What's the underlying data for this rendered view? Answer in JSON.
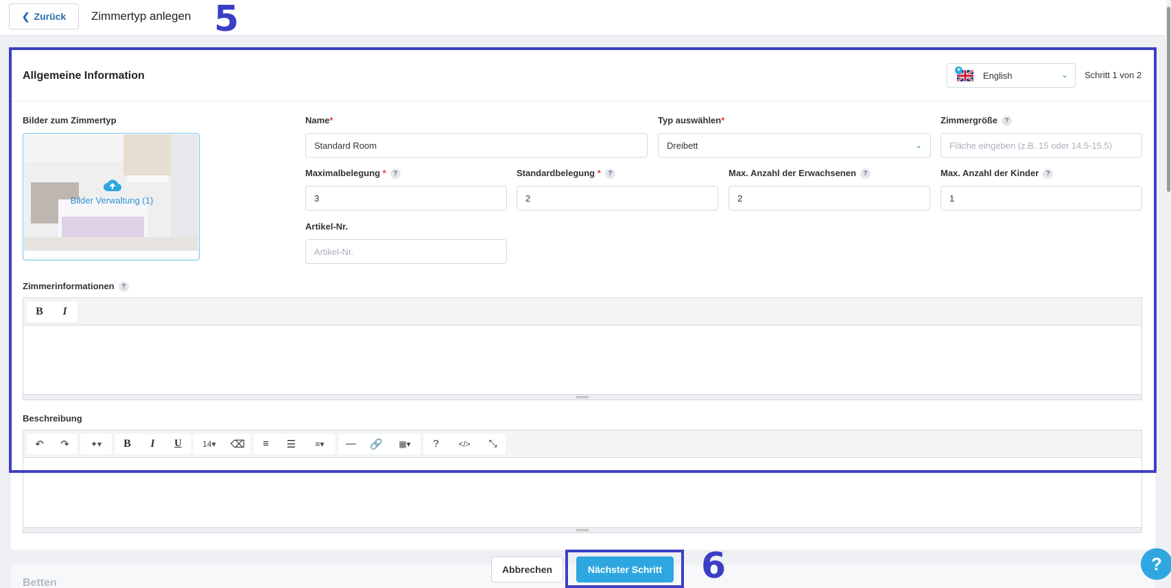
{
  "header": {
    "back_label": "Zurück",
    "title": "Zimmertyp anlegen",
    "annotation_step": "5"
  },
  "card": {
    "title": "Allgemeine Information",
    "language": "English",
    "step_text": "Schritt 1 von 2"
  },
  "images": {
    "label": "Bilder zum Zimmertyp",
    "manage_label": "Bilder Verwaltung (1)"
  },
  "fields": {
    "name": {
      "label": "Name",
      "value": "Standard Room"
    },
    "type": {
      "label": "Typ auswählen",
      "value": "Dreibett"
    },
    "size": {
      "label": "Zimmergröße",
      "placeholder": "Fläche eingeben (z.B. 15 oder 14.5-15.5)"
    },
    "max_occupancy": {
      "label": "Maximalbelegung",
      "value": "3"
    },
    "std_occupancy": {
      "label": "Standardbelegung",
      "value": "2"
    },
    "max_adults": {
      "label": "Max. Anzahl der Erwachsenen",
      "value": "2"
    },
    "max_children": {
      "label": "Max. Anzahl der Kinder",
      "value": "1"
    },
    "article_no": {
      "label": "Artikel-Nr.",
      "placeholder": "Artikel-Nr."
    }
  },
  "room_info": {
    "label": "Zimmerinformationen",
    "toolbar": {
      "bold": "B",
      "italic": "I"
    }
  },
  "description": {
    "label": "Beschreibung",
    "toolbar": {
      "bold": "B",
      "italic": "I",
      "underline": "U",
      "font_size": "14",
      "help": "?",
      "code": "</>"
    }
  },
  "beds": {
    "label": "Betten"
  },
  "footer": {
    "cancel_label": "Abbrechen",
    "next_label": "Nächster Schritt",
    "annotation_step": "6"
  },
  "help_fab": "?",
  "colors": {
    "accent": "#2ea7e0",
    "annotation": "#3b3fc4",
    "required": "#e23b3b"
  }
}
